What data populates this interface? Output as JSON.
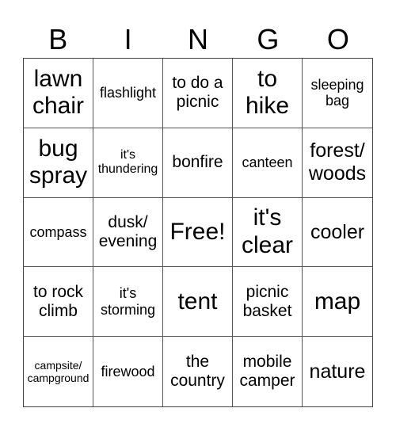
{
  "card": {
    "header": [
      "B",
      "I",
      "N",
      "G",
      "O"
    ],
    "cells": [
      {
        "text": "lawn chair",
        "size": "xl"
      },
      {
        "text": "flashlight",
        "size": "s"
      },
      {
        "text": "to do a picnic",
        "size": "m"
      },
      {
        "text": "to hike",
        "size": "xl"
      },
      {
        "text": "sleeping bag",
        "size": "s"
      },
      {
        "text": "bug spray",
        "size": "xl"
      },
      {
        "text": "it's thundering",
        "size": "xs"
      },
      {
        "text": "bonfire",
        "size": "m"
      },
      {
        "text": "canteen",
        "size": "s"
      },
      {
        "text": "forest/ woods",
        "size": "l"
      },
      {
        "text": "compass",
        "size": "s"
      },
      {
        "text": "dusk/ evening",
        "size": "m"
      },
      {
        "text": "Free!",
        "size": "xl"
      },
      {
        "text": "it's clear",
        "size": "xl"
      },
      {
        "text": "cooler",
        "size": "l"
      },
      {
        "text": "to rock climb",
        "size": "m"
      },
      {
        "text": "it's storming",
        "size": "s"
      },
      {
        "text": "tent",
        "size": "xl"
      },
      {
        "text": "picnic basket",
        "size": "m"
      },
      {
        "text": "map",
        "size": "xl"
      },
      {
        "text": "campsite/ campground",
        "size": "xxs"
      },
      {
        "text": "firewood",
        "size": "s"
      },
      {
        "text": "the country",
        "size": "m"
      },
      {
        "text": "mobile camper",
        "size": "m"
      },
      {
        "text": "nature",
        "size": "l"
      }
    ]
  }
}
